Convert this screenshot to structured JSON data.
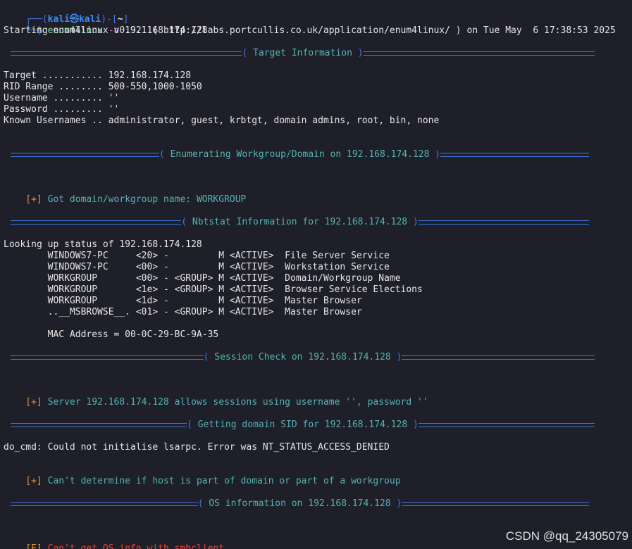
{
  "prompt": {
    "corner_top": "┌──(",
    "user": "kali",
    "at": "㉿",
    "host": "kali",
    "mid": ")-[",
    "cwd": "~",
    "end": "]",
    "corner_bottom": "└─",
    "symbol": "$",
    "command": "enum4linux",
    "flag": "-a",
    "argument": "192.168.174.128"
  },
  "start_line": "Starting enum4linux v0.9.1 ( http://labs.portcullis.co.uk/application/enum4linux/ ) on Tue May  6 17:38:53 2025",
  "sections": {
    "target": "Target Information",
    "workgroup": "Enumerating Workgroup/Domain on 192.168.174.128",
    "nbtstat": "Nbtstat Information for 192.168.174.128",
    "session": "Session Check on 192.168.174.128",
    "sid": "Getting domain SID for 192.168.174.128",
    "os": "OS information on 192.168.174.128"
  },
  "target_info": [
    "Target ........... 192.168.174.128",
    "RID Range ........ 500-550,1000-1050",
    "Username ......... ''",
    "Password ......... ''",
    "Known Usernames .. administrator, guest, krbtgt, domain admins, root, bin, none"
  ],
  "workgroup": {
    "tag": "[+]",
    "text": " Got domain/workgroup name: WORKGROUP"
  },
  "nbtstat": {
    "lookup": "Looking up status of 192.168.174.128",
    "rows": [
      "        WINDOWS7-PC     <20> -         M <ACTIVE>  File Server Service",
      "        WINDOWS7-PC     <00> -         M <ACTIVE>  Workstation Service",
      "        WORKGROUP       <00> - <GROUP> M <ACTIVE>  Domain/Workgroup Name",
      "        WORKGROUP       <1e> - <GROUP> M <ACTIVE>  Browser Service Elections",
      "        WORKGROUP       <1d> -         M <ACTIVE>  Master Browser",
      "        ..__MSBROWSE__. <01> - <GROUP> M <ACTIVE>  Master Browser"
    ],
    "mac": "        MAC Address = 00-0C-29-BC-9A-35"
  },
  "session": {
    "tag": "[+]",
    "text": " Server 192.168.174.128 allows sessions using username '', password ''"
  },
  "sid": {
    "error_line": "do_cmd: Could not initialise lsarpc. Error was NT_STATUS_ACCESS_DENIED",
    "tag": "[+]",
    "text": " Can't determine if host is part of domain or part of a workgroup"
  },
  "os": {
    "tag": "[E]",
    "text": " Can't get OS info with smbclient"
  },
  "watermark": "CSDN @qq_24305079",
  "colors": {
    "background": "#1e1f29",
    "rule_blue": "#3d79e0",
    "cyan_text": "#56b3b3",
    "orange_tag": "#e5962f",
    "red_error": "#e0453a"
  }
}
